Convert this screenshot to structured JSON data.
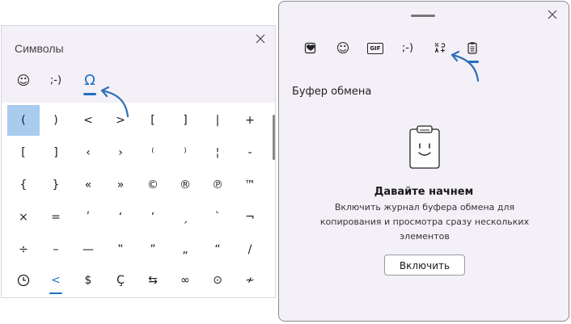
{
  "symbols_panel": {
    "title": "Символы",
    "tabs": [
      {
        "label": "☺",
        "name": "emoji"
      },
      {
        "label": ";-)",
        "name": "kaomoji"
      },
      {
        "label": "Ω",
        "name": "symbols",
        "active": true
      }
    ],
    "grid": [
      [
        "(",
        ")",
        "<",
        ">",
        "[",
        "]",
        "|",
        "+"
      ],
      [
        "[",
        "]",
        "‹",
        "›",
        "⁽",
        "⁾",
        "¦",
        "-"
      ],
      [
        "{",
        "}",
        "«",
        "»",
        "©",
        "®",
        "℗",
        "™"
      ],
      [
        "×",
        "=",
        "ʹ",
        "ʻ",
        "ʼ",
        "ˏ",
        "ˋ",
        "¬"
      ],
      [
        "÷",
        "–",
        "—",
        "‟",
        "”",
        "„",
        "“",
        "/"
      ]
    ],
    "categories": [
      "clock",
      "<",
      "$",
      "Ç",
      "⇆",
      "∞",
      "⊙",
      "≁"
    ],
    "selected_cell": "("
  },
  "clipboard_panel": {
    "tabs": [
      {
        "name": "recent"
      },
      {
        "name": "emoji",
        "label": "☺"
      },
      {
        "name": "gif",
        "label": "GIF"
      },
      {
        "name": "kaomoji",
        "label": ";-)"
      },
      {
        "name": "symbols"
      },
      {
        "name": "clipboard",
        "active": true
      }
    ],
    "section_title": "Буфер обмена",
    "empty_title": "Давайте начнем",
    "empty_description": "Включить журнал буфера обмена для копирования и просмотра сразу нескольких элементов",
    "enable_button": "Включить"
  },
  "colors": {
    "accent": "#1e6fc5",
    "panel_bg": "#f4f0f7",
    "selected_cell": "#a9cbee"
  }
}
